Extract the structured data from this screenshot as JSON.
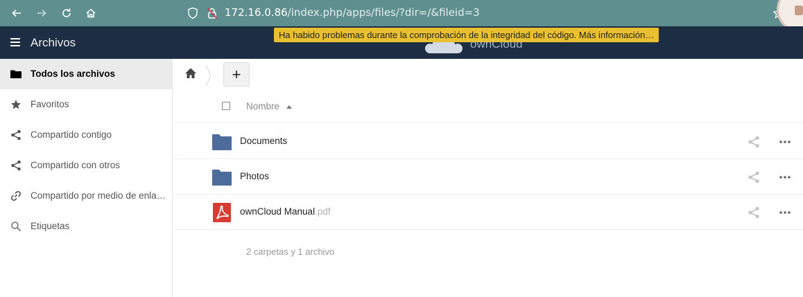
{
  "browser": {
    "url_host": "172.16.0.86",
    "url_path": "/index.php/apps/files/?dir=/&fileid=3"
  },
  "app": {
    "title": "Archivos",
    "logo_text": "ownCloud",
    "warning": "Ha habido problemas durante la comprobación de la integridad del código. Más información…"
  },
  "sidebar": {
    "items": [
      {
        "label": "Todos los archivos",
        "icon": "folder-icon",
        "active": true
      },
      {
        "label": "Favoritos",
        "icon": "star-icon",
        "active": false
      },
      {
        "label": "Compartido contigo",
        "icon": "share-icon",
        "active": false
      },
      {
        "label": "Compartido con otros",
        "icon": "share-icon",
        "active": false
      },
      {
        "label": "Compartido por medio de enlaces",
        "icon": "link-icon",
        "active": false
      },
      {
        "label": "Etiquetas",
        "icon": "search-icon",
        "active": false
      }
    ]
  },
  "toolbar": {
    "new_label": "+"
  },
  "table": {
    "name_header": "Nombre",
    "rows": [
      {
        "name": "Documents",
        "ext": "",
        "type": "folder"
      },
      {
        "name": "Photos",
        "ext": "",
        "type": "folder"
      },
      {
        "name": "ownCloud Manual",
        "ext": ".pdf",
        "type": "pdf"
      }
    ],
    "summary": "2 carpetas y 1 archivo"
  },
  "colors": {
    "browser_bar": "#5f8f8f",
    "header": "#1d2d44",
    "warning": "#e9c02f",
    "folder": "#4d6c9a",
    "pdf": "#d63c32"
  }
}
